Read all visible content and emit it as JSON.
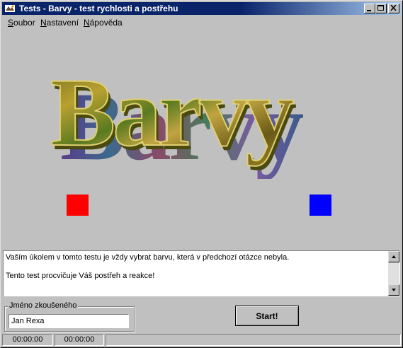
{
  "window": {
    "title": "Tests - Barvy - test rychlosti a postřehu"
  },
  "menu": [
    {
      "label": "Soubor",
      "accel": "S",
      "rest": "oubor"
    },
    {
      "label": "Nastavení",
      "accel": "N",
      "rest": "astavení"
    },
    {
      "label": "Nápověda",
      "accel": "N",
      "rest": "ápověda"
    }
  ],
  "logo": {
    "text": "Barvy"
  },
  "colors": {
    "left_swatch": "#ff0000",
    "right_swatch": "#0000ff",
    "titlebar": "#0a246a"
  },
  "instructions": {
    "line1": "Vaším úkolem v tomto testu je vždy vybrat barvu, která v předchozí otázce nebyla.",
    "line2": "Tento test procvičuje Váš postřeh a reakce!"
  },
  "examinee": {
    "label": "Jméno zkoušeného",
    "value": "Jan Rexa"
  },
  "start_button": "Start!",
  "status": {
    "elapsed": "00:00:00",
    "remaining": "00:00:00"
  }
}
